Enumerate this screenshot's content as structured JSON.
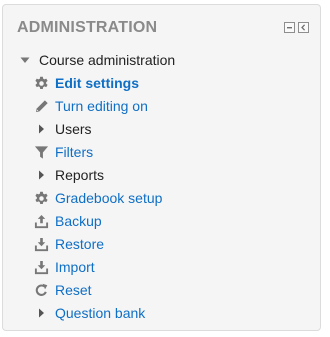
{
  "block": {
    "title": "ADMINISTRATION",
    "controls": [
      "dock-icon",
      "hide-icon"
    ]
  },
  "tree": {
    "root": {
      "label": "Course administration",
      "expanded": true
    },
    "items": [
      {
        "label": "Edit settings",
        "icon": "gear-icon",
        "type": "link",
        "bold": true
      },
      {
        "label": "Turn editing on",
        "icon": "pencil-icon",
        "type": "link",
        "bold": false
      },
      {
        "label": "Users",
        "icon": "caret-right-icon",
        "type": "branch",
        "bold": false
      },
      {
        "label": "Filters",
        "icon": "filter-icon",
        "type": "link",
        "bold": false
      },
      {
        "label": "Reports",
        "icon": "caret-right-icon",
        "type": "branch",
        "bold": false
      },
      {
        "label": "Gradebook setup",
        "icon": "gear-icon",
        "type": "link",
        "bold": false
      },
      {
        "label": "Backup",
        "icon": "upload-icon",
        "type": "link",
        "bold": false
      },
      {
        "label": "Restore",
        "icon": "download-icon",
        "type": "link",
        "bold": false
      },
      {
        "label": "Import",
        "icon": "download-icon",
        "type": "link",
        "bold": false
      },
      {
        "label": "Reset",
        "icon": "refresh-icon",
        "type": "link",
        "bold": false
      },
      {
        "label": "Question bank",
        "icon": "caret-right-icon",
        "type": "branch-link",
        "bold": false
      }
    ]
  },
  "colors": {
    "link": "#0f6fc5",
    "text": "#222222",
    "icon": "#777777",
    "title": "#8a8a8a",
    "panel": "#f5f5f5",
    "border": "#dcdcdc"
  }
}
